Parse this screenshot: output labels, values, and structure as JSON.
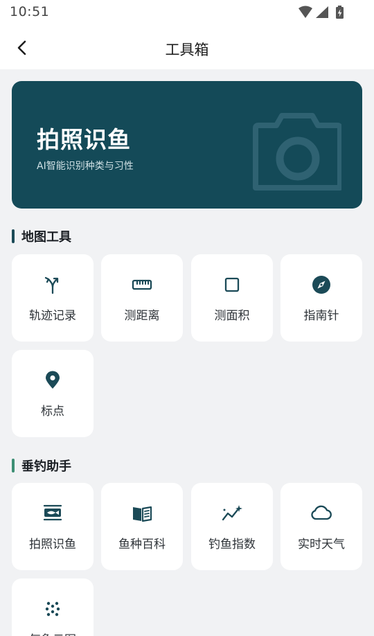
{
  "status": {
    "time": "10:51"
  },
  "header": {
    "title": "工具箱"
  },
  "hero": {
    "title": "拍照识鱼",
    "subtitle": "AI智能识别种类与习性"
  },
  "sections": [
    {
      "title": "地图工具",
      "accent": "#1b4a57",
      "tools": [
        {
          "label": "轨迹记录",
          "icon": "route-fork-icon"
        },
        {
          "label": "测距离",
          "icon": "ruler-icon"
        },
        {
          "label": "测面积",
          "icon": "square-icon"
        },
        {
          "label": "指南针",
          "icon": "compass-icon"
        },
        {
          "label": "标点",
          "icon": "map-pin-icon"
        }
      ]
    },
    {
      "title": "垂钓助手",
      "accent": "#3d8f74",
      "tools": [
        {
          "label": "拍照识鱼",
          "icon": "fish-scan-icon"
        },
        {
          "label": "鱼种百科",
          "icon": "book-icon"
        },
        {
          "label": "钓鱼指数",
          "icon": "trend-sparkle-icon"
        },
        {
          "label": "实时天气",
          "icon": "cloud-icon"
        },
        {
          "label": "气象云图",
          "icon": "dots-grid-icon"
        }
      ]
    }
  ],
  "colors": {
    "primary": "#144a58",
    "icon": "#1b4a57",
    "background": "#f1f2f4"
  }
}
